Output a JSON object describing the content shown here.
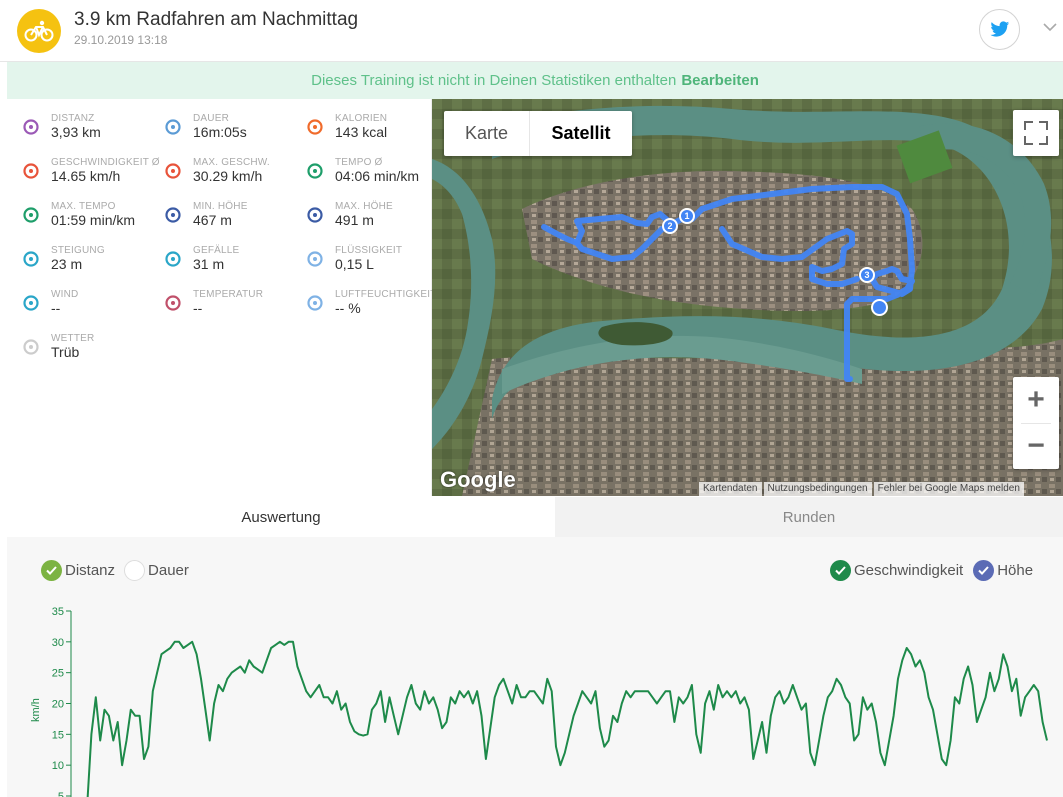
{
  "header": {
    "title": "3.9 km Radfahren am Nachmittag",
    "date": "29.10.2019 13:18"
  },
  "banner": {
    "text": "Dieses Training ist nicht in Deinen Statistiken enthalten",
    "link": "Bearbeiten"
  },
  "stats": [
    {
      "label": "DISTANZ",
      "value": "3,93 km",
      "icon": "distance-pin-icon",
      "color": "#9b59b6"
    },
    {
      "label": "DAUER",
      "value": "16m:05s",
      "icon": "stopwatch-icon",
      "color": "#5b9bd5"
    },
    {
      "label": "KALORIEN",
      "value": "143 kcal",
      "icon": "flame-icon",
      "color": "#f06b2b"
    },
    {
      "label": "GESCHWINDIGKEIT Ø",
      "value": "14.65 km/h",
      "icon": "speedometer-icon",
      "color": "#e8533a"
    },
    {
      "label": "MAX. GESCHW.",
      "value": "30.29 km/h",
      "icon": "speedometer-max-icon",
      "color": "#e8533a"
    },
    {
      "label": "TEMPO Ø",
      "value": "04:06 min/km",
      "icon": "pace-icon",
      "color": "#1e9e6a"
    },
    {
      "label": "MAX. TEMPO",
      "value": "01:59 min/km",
      "icon": "pace-max-icon",
      "color": "#1e9e6a"
    },
    {
      "label": "MIN. HÖHE",
      "value": "467 m",
      "icon": "mountain-min-icon",
      "color": "#3b5ba5"
    },
    {
      "label": "MAX. HÖHE",
      "value": "491 m",
      "icon": "mountain-max-icon",
      "color": "#3b5ba5"
    },
    {
      "label": "STEIGUNG",
      "value": "23 m",
      "icon": "ascent-icon",
      "color": "#2aa6c8"
    },
    {
      "label": "GEFÄLLE",
      "value": "31 m",
      "icon": "descent-icon",
      "color": "#2aa6c8"
    },
    {
      "label": "FLÜSSIGKEIT",
      "value": "0,15 L",
      "icon": "water-drops-icon",
      "color": "#7fb2e5"
    },
    {
      "label": "WIND",
      "value": "--",
      "icon": "wind-icon",
      "color": "#2aa6c8"
    },
    {
      "label": "TEMPERATUR",
      "value": "--",
      "icon": "thermometer-icon",
      "color": "#c0506a"
    },
    {
      "label": "LUFTFEUCHTIGKEIT",
      "value": "-- %",
      "icon": "humidity-icon",
      "color": "#7fb2e5"
    },
    {
      "label": "WETTER",
      "value": "Trüb",
      "icon": "cloud-icon",
      "color": "#cccccc"
    }
  ],
  "map": {
    "karte": "Karte",
    "satellit": "Satellit",
    "google": "Google",
    "attribution": [
      "Kartendaten",
      "Nutzungsbedingungen",
      "Fehler bei Google Maps melden"
    ],
    "markers": [
      "1",
      "2",
      "3"
    ]
  },
  "tabs": {
    "auswertung": "Auswertung",
    "runden": "Runden"
  },
  "legend": {
    "distanz": "Distanz",
    "dauer": "Dauer",
    "geschwindigkeit": "Geschwindigkeit",
    "hoehe": "Höhe"
  },
  "colors": {
    "speed_line": "#1e8a4a",
    "route": "#4285f4",
    "accent_green": "#5fc18a"
  },
  "chart_data": {
    "type": "line",
    "ylabel": "km/h",
    "yticks": [
      5,
      10,
      15,
      20,
      25,
      30,
      35
    ],
    "ylim": [
      5,
      35
    ],
    "series": [
      {
        "name": "Geschwindigkeit",
        "values": [
          3,
          15,
          21,
          14,
          19,
          18,
          14,
          17,
          10,
          14,
          19,
          18,
          18,
          11,
          13,
          22,
          25,
          28,
          28.5,
          29,
          30,
          30,
          29,
          29.5,
          30,
          28,
          24,
          19,
          14,
          20,
          23,
          22,
          24,
          25,
          25.5,
          26,
          25,
          27,
          26,
          25.5,
          25,
          27,
          29,
          29.5,
          30,
          29.5,
          30,
          30,
          26,
          24,
          22,
          21,
          22,
          23,
          21,
          21,
          20,
          22,
          19,
          20,
          17,
          15.5,
          15,
          14.8,
          15,
          19,
          20,
          22,
          17,
          21,
          18,
          15,
          18,
          21,
          23,
          20,
          19,
          22,
          20,
          21,
          19,
          16,
          17,
          21,
          20,
          22,
          21,
          22,
          20,
          22,
          18,
          11,
          16,
          21,
          23,
          24,
          22,
          20,
          23,
          21,
          21,
          22,
          22,
          21,
          20,
          24,
          22,
          13,
          10,
          12,
          15,
          18,
          20,
          22,
          21,
          20,
          22,
          16,
          13,
          14,
          18,
          17,
          20,
          22,
          21,
          22,
          22,
          22,
          22,
          21,
          20,
          21,
          22,
          22,
          17,
          21,
          20,
          21,
          23,
          15,
          12,
          20,
          22,
          19,
          23,
          21,
          22,
          21,
          22,
          20,
          21,
          19,
          11,
          14,
          17,
          12,
          18,
          21,
          22,
          20,
          21,
          23,
          21,
          19,
          20,
          12,
          10,
          14,
          18,
          21,
          22,
          24,
          23,
          21,
          20,
          14,
          15,
          21,
          19,
          20,
          17,
          12,
          10,
          14,
          18,
          24,
          27,
          29,
          28,
          26,
          27,
          25,
          21,
          19,
          15,
          11,
          10,
          14,
          21,
          20,
          24,
          26,
          23,
          17,
          19,
          21,
          25,
          22,
          24,
          28,
          26,
          22,
          24,
          18,
          21,
          22,
          23,
          22,
          17,
          14
        ]
      }
    ]
  }
}
